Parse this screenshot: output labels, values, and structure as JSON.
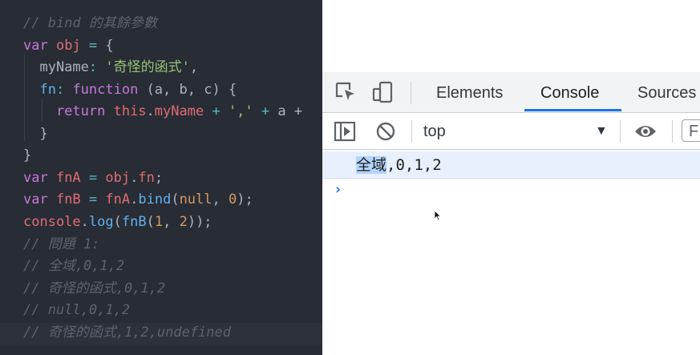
{
  "editor": {
    "lines": [
      [
        {
          "c": "cm",
          "t": "// bind 的其餘參數"
        }
      ],
      [
        {
          "c": "kw",
          "t": "var "
        },
        {
          "c": "vr",
          "t": "obj"
        },
        {
          "c": "op",
          "t": " = "
        },
        {
          "c": "pl",
          "t": "{"
        }
      ],
      [
        {
          "c": "pl",
          "t": "  myName"
        },
        {
          "c": "op",
          "t": ": "
        },
        {
          "c": "str",
          "t": "'奇怪的函式'"
        },
        {
          "c": "pl",
          "t": ","
        }
      ],
      [
        {
          "c": "fn",
          "t": "  fn"
        },
        {
          "c": "op",
          "t": ": "
        },
        {
          "c": "kw",
          "t": "function "
        },
        {
          "c": "pl",
          "t": "(a, b, c) {"
        }
      ],
      [
        {
          "c": "kw",
          "t": "    return "
        },
        {
          "c": "vr",
          "t": "this"
        },
        {
          "c": "pl",
          "t": "."
        },
        {
          "c": "vr",
          "t": "myName"
        },
        {
          "c": "op",
          "t": " + "
        },
        {
          "c": "str",
          "t": "','"
        },
        {
          "c": "op",
          "t": " + "
        },
        {
          "c": "pl",
          "t": "a +"
        }
      ],
      [
        {
          "c": "pl",
          "t": "  }"
        }
      ],
      [
        {
          "c": "pl",
          "t": "}"
        }
      ],
      [
        {
          "c": "kw",
          "t": "var "
        },
        {
          "c": "vr",
          "t": "fnA"
        },
        {
          "c": "op",
          "t": " = "
        },
        {
          "c": "vr",
          "t": "obj"
        },
        {
          "c": "pl",
          "t": "."
        },
        {
          "c": "vr",
          "t": "fn"
        },
        {
          "c": "pl",
          "t": ";"
        }
      ],
      [
        {
          "c": "kw",
          "t": "var "
        },
        {
          "c": "vr",
          "t": "fnB"
        },
        {
          "c": "op",
          "t": " = "
        },
        {
          "c": "vr",
          "t": "fnA"
        },
        {
          "c": "pl",
          "t": "."
        },
        {
          "c": "fn",
          "t": "bind"
        },
        {
          "c": "pl",
          "t": "("
        },
        {
          "c": "num",
          "t": "null"
        },
        {
          "c": "pl",
          "t": ", "
        },
        {
          "c": "num",
          "t": "0"
        },
        {
          "c": "pl",
          "t": ");"
        }
      ],
      [
        {
          "c": "vr",
          "t": "console"
        },
        {
          "c": "pl",
          "t": "."
        },
        {
          "c": "fn",
          "t": "log"
        },
        {
          "c": "pl",
          "t": "("
        },
        {
          "c": "fn",
          "t": "fnB"
        },
        {
          "c": "pl",
          "t": "("
        },
        {
          "c": "num",
          "t": "1"
        },
        {
          "c": "pl",
          "t": ", "
        },
        {
          "c": "num",
          "t": "2"
        },
        {
          "c": "pl",
          "t": "));"
        }
      ],
      [
        {
          "c": "cm",
          "t": "// 問題 1:"
        }
      ],
      [
        {
          "c": "cm",
          "t": "// 全域,0,1,2"
        }
      ],
      [
        {
          "c": "cm",
          "t": "// 奇怪的函式,0,1,2"
        }
      ],
      [
        {
          "c": "cm",
          "t": "// null,0,1,2"
        }
      ],
      [
        {
          "c": "cm",
          "t": "// 奇怪的函式,1,2,undefined"
        }
      ]
    ]
  },
  "devtools": {
    "tabs": [
      "Elements",
      "Console",
      "Sources"
    ],
    "active_tab": "Console",
    "context": "top",
    "filter_placeholder": "F",
    "log": {
      "selected_text": "全域",
      "rest_text": ",0,1,2"
    },
    "prompt_symbol": "›",
    "colors": {
      "accent": "#1a73e8",
      "log_bg": "#e8f0fe",
      "editor_bg": "#282c34"
    }
  }
}
